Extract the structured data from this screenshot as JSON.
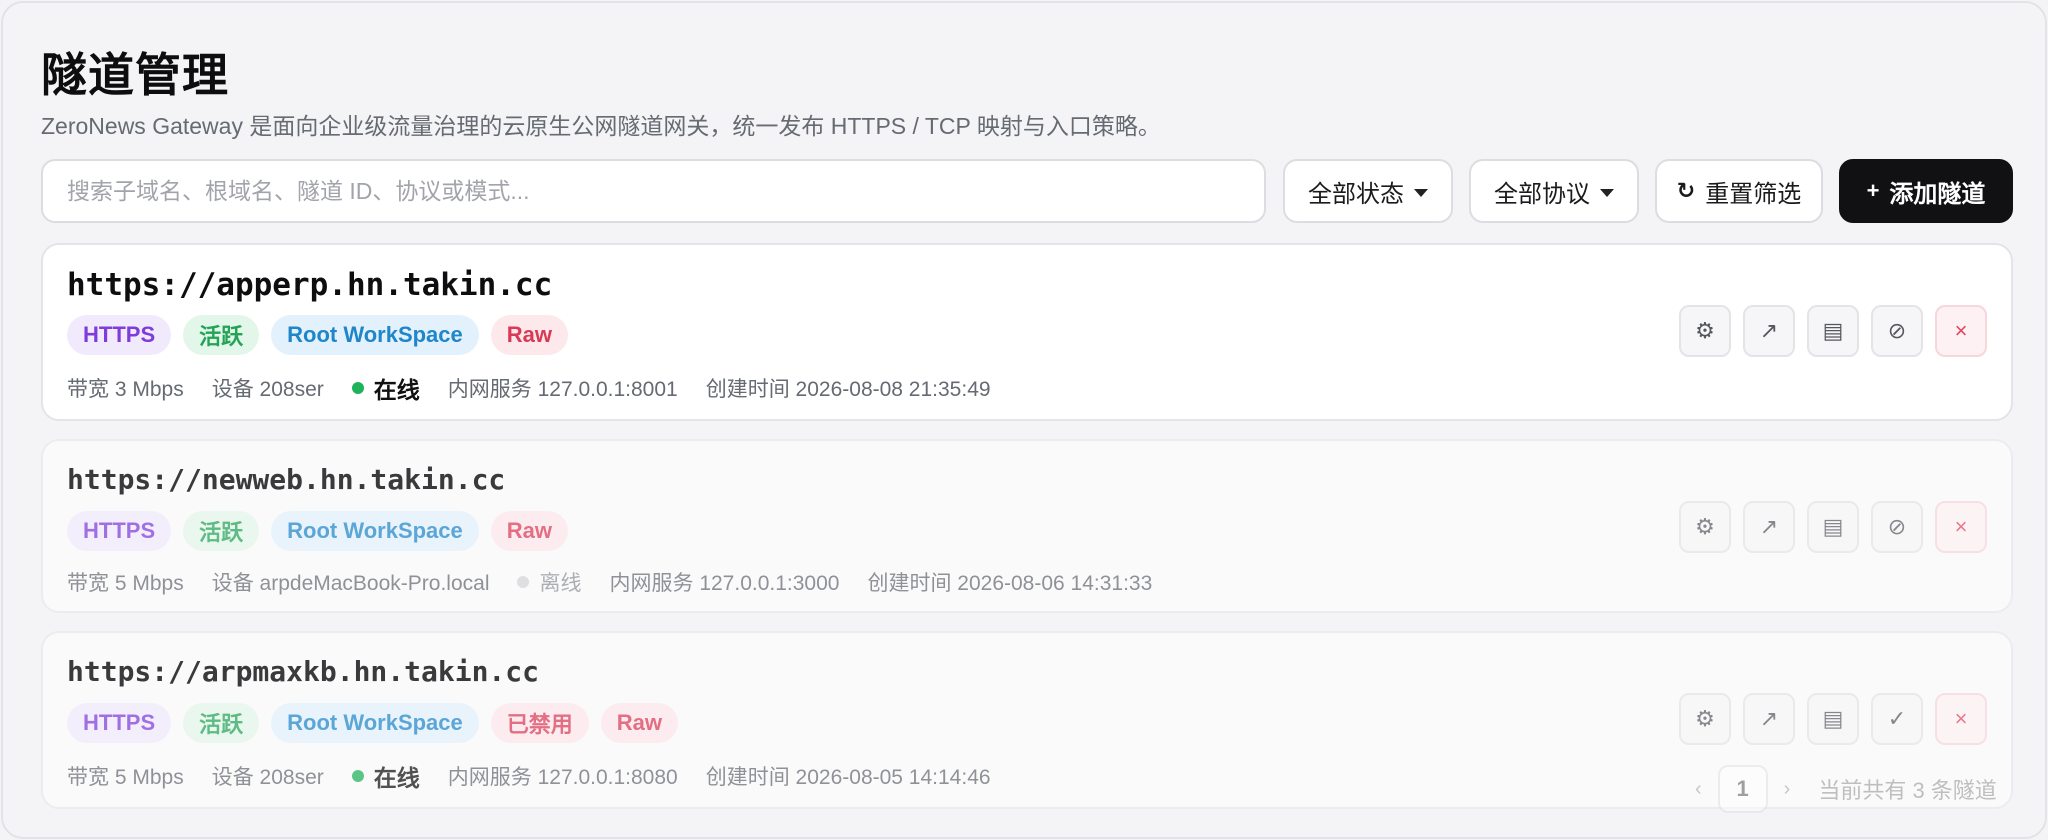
{
  "header": {
    "title": "隧道管理",
    "subtitle": "ZeroNews Gateway 是面向企业级流量治理的云原生公网隧道网关，统一发布 HTTPS / TCP 映射与入口策略。"
  },
  "toolbar": {
    "search_placeholder": "搜索子域名、根域名、隧道 ID、协议或模式...",
    "status_filter": "全部状态",
    "protocol_filter": "全部协议",
    "reset_label": "重置筛选",
    "reset_icon": "↻",
    "add_label": "添加隧道",
    "add_icon": "+"
  },
  "tunnels": [
    {
      "url": "https://apperp.hn.takin.cc",
      "badges": {
        "protocol": "HTTPS",
        "state": "活跃",
        "workspace": "Root WorkSpace",
        "mode": "Raw"
      },
      "bandwidth": "带宽 3 Mbps",
      "device": "设备 208ser",
      "status": "在线",
      "service": "内网服务 127.0.0.1:8001",
      "created": "创建时间 2026-08-08 21:35:49",
      "toggle_icon": "⊘"
    },
    {
      "url": "https://newweb.hn.takin.cc",
      "badges": {
        "protocol": "HTTPS",
        "state": "活跃",
        "workspace": "Root WorkSpace",
        "mode": "Raw"
      },
      "bandwidth": "带宽 5 Mbps",
      "device": "设备 arpdeMacBook-Pro.local",
      "status": "离线",
      "service": "内网服务 127.0.0.1:3000",
      "created": "创建时间 2026-08-06 14:31:33",
      "toggle_icon": "⊘"
    },
    {
      "url": "https://arpmaxkb.hn.takin.cc",
      "badges": {
        "protocol": "HTTPS",
        "state": "活跃",
        "workspace": "Root WorkSpace",
        "disabled": "已禁用",
        "mode": "Raw"
      },
      "bandwidth": "带宽 5 Mbps",
      "device": "设备 208ser",
      "status": "在线",
      "service": "内网服务 127.0.0.1:8080",
      "created": "创建时间 2026-08-05 14:14:46",
      "toggle_icon": "✓"
    }
  ],
  "action_icons": {
    "settings": "⚙",
    "open": "↗",
    "logs": "▤",
    "delete": "×"
  },
  "pagination": {
    "prev": "‹",
    "current": "1",
    "next": "›",
    "total": "当前共有 3 条隧道"
  },
  "colors": {
    "primary_button": "#111114",
    "online": "#20b25a",
    "offline": "#d5d5d8",
    "danger": "#e0455f"
  }
}
